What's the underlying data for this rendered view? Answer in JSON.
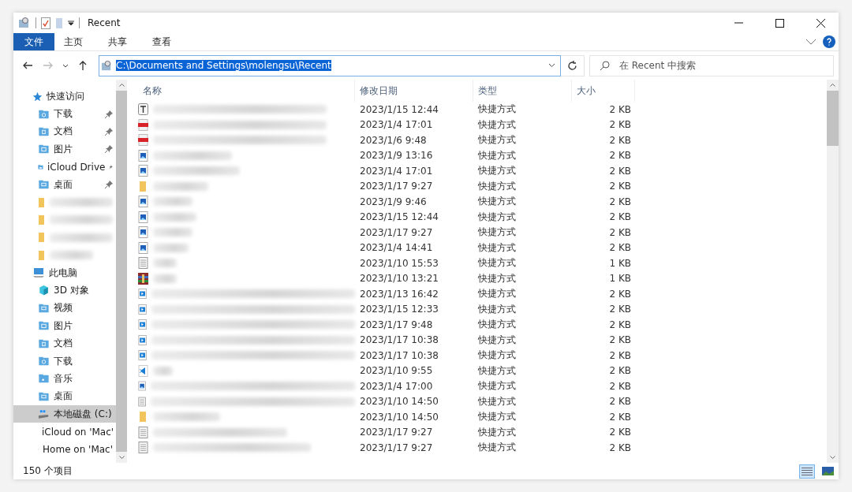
{
  "window": {
    "title": "Recent"
  },
  "ribbon_tabs": [
    {
      "label": "文件",
      "selected": true
    },
    {
      "label": "主页",
      "selected": false
    },
    {
      "label": "共享",
      "selected": false
    },
    {
      "label": "查看",
      "selected": false
    }
  ],
  "address": {
    "value": "C:\\Documents and Settings\\molengsu\\Recent"
  },
  "search": {
    "placeholder": "在 Recent 中搜索"
  },
  "sidebar": {
    "items": [
      {
        "kind": "header",
        "label": "快速访问",
        "selected": false
      },
      {
        "kind": "item",
        "label": "下载",
        "pinned": true,
        "selected": false
      },
      {
        "kind": "item",
        "label": "文档",
        "pinned": true,
        "selected": false
      },
      {
        "kind": "item",
        "label": "图片",
        "pinned": true,
        "selected": false
      },
      {
        "kind": "item",
        "label": "iCloud Drive",
        "pinned": true,
        "selected": false
      },
      {
        "kind": "item",
        "label": "桌面",
        "pinned": true,
        "selected": false
      },
      {
        "kind": "blurred",
        "selected": false
      },
      {
        "kind": "blurred",
        "selected": false
      },
      {
        "kind": "blurred",
        "selected": false
      },
      {
        "kind": "blurred",
        "selected": false
      },
      {
        "kind": "header",
        "label": "此电脑",
        "selected": false
      },
      {
        "kind": "item",
        "label": "3D 对象",
        "pinned": false,
        "selected": false
      },
      {
        "kind": "item",
        "label": "视频",
        "pinned": false,
        "selected": false
      },
      {
        "kind": "item",
        "label": "图片",
        "pinned": false,
        "selected": false
      },
      {
        "kind": "item",
        "label": "文档",
        "pinned": false,
        "selected": false
      },
      {
        "kind": "item",
        "label": "下载",
        "pinned": false,
        "selected": false
      },
      {
        "kind": "item",
        "label": "音乐",
        "pinned": false,
        "selected": false
      },
      {
        "kind": "item",
        "label": "桌面",
        "pinned": false,
        "selected": false
      },
      {
        "kind": "item",
        "label": "本地磁盘 (C:)",
        "pinned": false,
        "selected": true
      },
      {
        "kind": "item",
        "label": "iCloud on 'Mac'",
        "pinned": false,
        "selected": false
      },
      {
        "kind": "item",
        "label": "Home on 'Mac'",
        "pinned": false,
        "selected": false
      }
    ]
  },
  "table": {
    "columns": [
      "名称",
      "修改日期",
      "类型",
      "大小"
    ],
    "rows": [
      {
        "kind": "text",
        "date": "2023/1/15 12:44",
        "type": "快捷方式",
        "size": "2 KB"
      },
      {
        "kind": "pdf",
        "date": "2023/1/4 17:01",
        "type": "快捷方式",
        "size": "2 KB"
      },
      {
        "kind": "pdf",
        "date": "2023/1/6 9:48",
        "type": "快捷方式",
        "size": "2 KB"
      },
      {
        "kind": "image",
        "date": "2023/1/9 13:16",
        "type": "快捷方式",
        "size": "2 KB"
      },
      {
        "kind": "image",
        "date": "2023/1/4 17:01",
        "type": "快捷方式",
        "size": "2 KB"
      },
      {
        "kind": "folder",
        "date": "2023/1/17 9:27",
        "type": "快捷方式",
        "size": "2 KB"
      },
      {
        "kind": "image",
        "date": "2023/1/9 9:46",
        "type": "快捷方式",
        "size": "2 KB"
      },
      {
        "kind": "image",
        "date": "2023/1/15 12:44",
        "type": "快捷方式",
        "size": "2 KB"
      },
      {
        "kind": "image",
        "date": "2023/1/17 9:27",
        "type": "快捷方式",
        "size": "2 KB"
      },
      {
        "kind": "image",
        "date": "2023/1/4 14:41",
        "type": "快捷方式",
        "size": "2 KB"
      },
      {
        "kind": "doc",
        "date": "2023/1/10 15:53",
        "type": "快捷方式",
        "size": "1 KB"
      },
      {
        "kind": "archive",
        "date": "2023/1/10 13:21",
        "type": "快捷方式",
        "size": "1 KB"
      },
      {
        "kind": "video",
        "date": "2023/1/13 16:42",
        "type": "快捷方式",
        "size": "2 KB"
      },
      {
        "kind": "video",
        "date": "2023/1/15 12:33",
        "type": "快捷方式",
        "size": "2 KB"
      },
      {
        "kind": "video",
        "date": "2023/1/17 9:48",
        "type": "快捷方式",
        "size": "2 KB"
      },
      {
        "kind": "video",
        "date": "2023/1/17 10:38",
        "type": "快捷方式",
        "size": "2 KB"
      },
      {
        "kind": "video",
        "date": "2023/1/17 10:38",
        "type": "快捷方式",
        "size": "2 KB"
      },
      {
        "kind": "code",
        "date": "2023/1/10 9:55",
        "type": "快捷方式",
        "size": "2 KB"
      },
      {
        "kind": "image",
        "date": "2023/1/4 17:00",
        "type": "快捷方式",
        "size": "2 KB"
      },
      {
        "kind": "doc",
        "date": "2023/1/10 14:50",
        "type": "快捷方式",
        "size": "2 KB"
      },
      {
        "kind": "folder",
        "date": "2023/1/10 14:50",
        "type": "快捷方式",
        "size": "2 KB"
      },
      {
        "kind": "doc",
        "date": "2023/1/17 9:27",
        "type": "快捷方式",
        "size": "2 KB"
      },
      {
        "kind": "doc",
        "date": "2023/1/17 9:27",
        "type": "快捷方式",
        "size": "2 KB"
      }
    ]
  },
  "status_bar": {
    "count": "150 个项目"
  },
  "view_buttons": [
    {
      "kind": "details",
      "selected": true
    },
    {
      "kind": "thumbnails",
      "selected": false
    }
  ]
}
